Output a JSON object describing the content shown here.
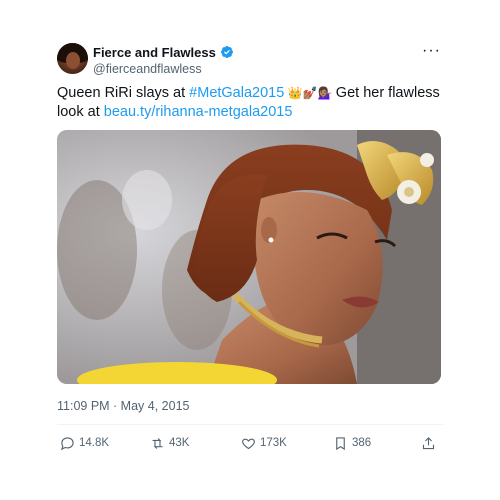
{
  "tweet": {
    "author": {
      "display_name": "Fierce and Flawless",
      "handle": "@fierceandflawless",
      "verified": true,
      "avatar_icon": "profile-photo"
    },
    "more_label": "···",
    "text": {
      "part1": "Queen RiRi slays at ",
      "hashtag": "#MetGala2015",
      "emojis": " 👑💅🏽💁🏽‍♀️ ",
      "part2": "Get her flawless look at ",
      "link": "beau.ty/rihanna-metgala2015"
    },
    "timestamp": "11:09 PM · May 4, 2015",
    "actions": {
      "replies": "14.8K",
      "retweets": "43K",
      "likes": "173K",
      "bookmarks": "386"
    },
    "colors": {
      "accent": "#1d9bf0",
      "text": "#0f1419",
      "secondary": "#536471"
    }
  }
}
